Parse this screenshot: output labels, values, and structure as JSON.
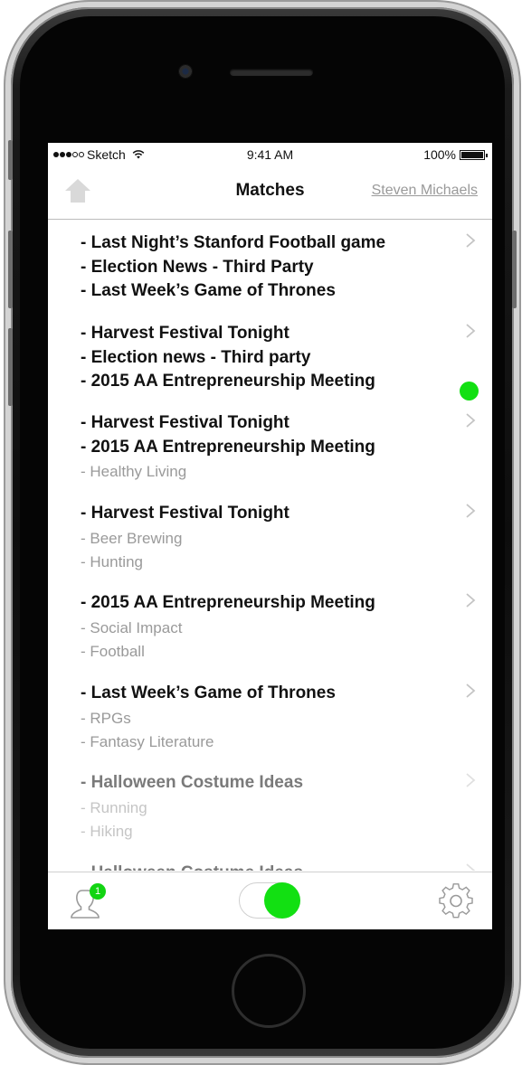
{
  "status_bar": {
    "carrier": "Sketch",
    "time": "9:41 AM",
    "battery": "100%",
    "icons": [
      "signal-dots-icon",
      "wifi-icon",
      "battery-icon"
    ]
  },
  "navbar": {
    "title": "Matches",
    "user_link": "Steven Michaels",
    "home_icon": "home-icon"
  },
  "matches": [
    {
      "lines": [
        {
          "text": "- Last Night’s Stanford Football game",
          "style": "strong"
        },
        {
          "text": "- Election News - Third Party",
          "style": "strong"
        },
        {
          "text": "- Last Week’s Game of Thrones",
          "style": "strong"
        }
      ],
      "online": false
    },
    {
      "lines": [
        {
          "text": "- Harvest Festival Tonight",
          "style": "strong"
        },
        {
          "text": "- Election news - Third party",
          "style": "strong"
        },
        {
          "text": "- 2015 AA Entrepreneurship Meeting",
          "style": "strong"
        }
      ],
      "online": true
    },
    {
      "lines": [
        {
          "text": "- Harvest Festival Tonight",
          "style": "strong"
        },
        {
          "text": "- 2015 AA Entrepreneurship Meeting",
          "style": "strong"
        },
        {
          "text": "- Healthy Living",
          "style": "faint"
        }
      ],
      "online": false
    },
    {
      "lines": [
        {
          "text": "- Harvest Festival Tonight",
          "style": "strong"
        },
        {
          "text": "- Beer Brewing",
          "style": "faint"
        },
        {
          "text": "- Hunting",
          "style": "faint"
        }
      ],
      "online": false
    },
    {
      "lines": [
        {
          "text": "- 2015 AA Entrepreneurship Meeting",
          "style": "strong"
        },
        {
          "text": "- Social Impact",
          "style": "faint"
        },
        {
          "text": "- Football",
          "style": "faint"
        }
      ],
      "online": false
    },
    {
      "lines": [
        {
          "text": "- Last Week’s Game of Thrones",
          "style": "strong"
        },
        {
          "text": "- RPGs",
          "style": "faint"
        },
        {
          "text": "- Fantasy Literature",
          "style": "faint"
        }
      ],
      "online": false
    },
    {
      "lines": [
        {
          "text": "- Halloween Costume Ideas",
          "style": "strong"
        },
        {
          "text": "- Running",
          "style": "faint"
        },
        {
          "text": "- Hiking",
          "style": "faint"
        }
      ],
      "online": false,
      "greyed": true
    },
    {
      "lines": [
        {
          "text": "- Halloween Costume Ideas",
          "style": "strong"
        }
      ],
      "online": false,
      "greyed": true
    }
  ],
  "tabbar": {
    "notification_count": "1",
    "toggle_on": true,
    "accent_color": "#12e012",
    "icons": [
      "user-icon",
      "toggle-switch",
      "gear-icon"
    ]
  }
}
